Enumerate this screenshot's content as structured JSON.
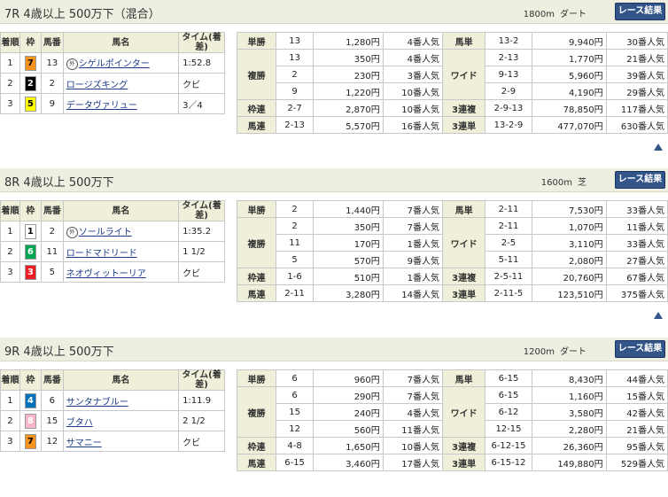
{
  "button_label": "レース結果",
  "res_headers": {
    "rank": "着順",
    "frame": "枠",
    "num": "馬番",
    "name": "馬名",
    "time": "タイム(着差)"
  },
  "pay_labels": {
    "tansho": "単勝",
    "fukusho": "複勝",
    "wakuren": "枠連",
    "umaren": "馬連",
    "umatan": "馬単",
    "wide": "ワイド",
    "sanrenpuku": "3連複",
    "sanrentan": "3連単"
  },
  "colors": {
    "header_bg": "#eeeee1",
    "th_bg": "#f0efd9",
    "button": "#335588",
    "link": "#1b3a8a"
  },
  "races": [
    {
      "title": "7R 4歳以上 500万下（混合）",
      "distance": "1800m",
      "surface": "ダート",
      "horses": [
        {
          "rank": "1",
          "frame": "7",
          "frame_bg": "#f7941d",
          "frame_fg": "#000000",
          "num": "13",
          "mark": "外",
          "name": "シゲルポインター",
          "time": "1:52.8"
        },
        {
          "rank": "2",
          "frame": "2",
          "frame_bg": "#000000",
          "frame_fg": "#ffffff",
          "num": "2",
          "mark": "",
          "name": "ロージズキング",
          "time": "クビ"
        },
        {
          "rank": "3",
          "frame": "5",
          "frame_bg": "#ffff00",
          "frame_fg": "#000000",
          "num": "9",
          "mark": "",
          "name": "データヴァリュー",
          "time": "3／4"
        }
      ],
      "payouts": {
        "tansho": {
          "combo": "13",
          "amount": "1,280円",
          "pop": "4番人気"
        },
        "fukusho": [
          {
            "combo": "13",
            "amount": "350円",
            "pop": "4番人気"
          },
          {
            "combo": "2",
            "amount": "230円",
            "pop": "3番人気"
          },
          {
            "combo": "9",
            "amount": "1,220円",
            "pop": "10番人気"
          }
        ],
        "wakuren": {
          "combo": "2-7",
          "amount": "2,870円",
          "pop": "10番人気"
        },
        "umaren": {
          "combo": "2-13",
          "amount": "5,570円",
          "pop": "16番人気"
        },
        "umatan": {
          "combo": "13-2",
          "amount": "9,940円",
          "pop": "30番人気"
        },
        "wide": [
          {
            "combo": "2-13",
            "amount": "1,770円",
            "pop": "21番人気"
          },
          {
            "combo": "9-13",
            "amount": "5,960円",
            "pop": "39番人気"
          },
          {
            "combo": "2-9",
            "amount": "4,190円",
            "pop": "29番人気"
          }
        ],
        "sanrenpuku": {
          "combo": "2-9-13",
          "amount": "78,850円",
          "pop": "117番人気"
        },
        "sanrentan": {
          "combo": "13-2-9",
          "amount": "477,070円",
          "pop": "630番人気"
        }
      }
    },
    {
      "title": "8R 4歳以上 500万下",
      "distance": "1600m",
      "surface": "芝",
      "horses": [
        {
          "rank": "1",
          "frame": "1",
          "frame_bg": "#ffffff",
          "frame_fg": "#000000",
          "num": "2",
          "mark": "外",
          "name": "ソールライト",
          "time": "1:35.2"
        },
        {
          "rank": "2",
          "frame": "6",
          "frame_bg": "#00a651",
          "frame_fg": "#ffffff",
          "num": "11",
          "mark": "",
          "name": "ロードマドリード",
          "time": "1 1/2"
        },
        {
          "rank": "3",
          "frame": "3",
          "frame_bg": "#ed1c24",
          "frame_fg": "#ffffff",
          "num": "5",
          "mark": "",
          "name": "ネオヴィットーリア",
          "time": "クビ"
        }
      ],
      "payouts": {
        "tansho": {
          "combo": "2",
          "amount": "1,440円",
          "pop": "7番人気"
        },
        "fukusho": [
          {
            "combo": "2",
            "amount": "350円",
            "pop": "7番人気"
          },
          {
            "combo": "11",
            "amount": "170円",
            "pop": "1番人気"
          },
          {
            "combo": "5",
            "amount": "570円",
            "pop": "9番人気"
          }
        ],
        "wakuren": {
          "combo": "1-6",
          "amount": "510円",
          "pop": "1番人気"
        },
        "umaren": {
          "combo": "2-11",
          "amount": "3,280円",
          "pop": "14番人気"
        },
        "umatan": {
          "combo": "2-11",
          "amount": "7,530円",
          "pop": "33番人気"
        },
        "wide": [
          {
            "combo": "2-11",
            "amount": "1,070円",
            "pop": "11番人気"
          },
          {
            "combo": "2-5",
            "amount": "3,110円",
            "pop": "33番人気"
          },
          {
            "combo": "5-11",
            "amount": "2,080円",
            "pop": "27番人気"
          }
        ],
        "sanrenpuku": {
          "combo": "2-5-11",
          "amount": "20,760円",
          "pop": "67番人気"
        },
        "sanrentan": {
          "combo": "2-11-5",
          "amount": "123,510円",
          "pop": "375番人気"
        }
      }
    },
    {
      "title": "9R 4歳以上 500万下",
      "distance": "1200m",
      "surface": "ダート",
      "horses": [
        {
          "rank": "1",
          "frame": "4",
          "frame_bg": "#0072bc",
          "frame_fg": "#ffffff",
          "num": "6",
          "mark": "",
          "name": "サンタナブルー",
          "time": "1:11.9"
        },
        {
          "rank": "2",
          "frame": "8",
          "frame_bg": "#f9b6c8",
          "frame_fg": "#ffffff",
          "num": "15",
          "mark": "",
          "name": "ブタハ",
          "time": "2 1/2"
        },
        {
          "rank": "3",
          "frame": "7",
          "frame_bg": "#f7941d",
          "frame_fg": "#000000",
          "num": "12",
          "mark": "",
          "name": "サマニー",
          "time": "クビ"
        }
      ],
      "payouts": {
        "tansho": {
          "combo": "6",
          "amount": "960円",
          "pop": "7番人気"
        },
        "fukusho": [
          {
            "combo": "6",
            "amount": "290円",
            "pop": "7番人気"
          },
          {
            "combo": "15",
            "amount": "240円",
            "pop": "4番人気"
          },
          {
            "combo": "12",
            "amount": "560円",
            "pop": "11番人気"
          }
        ],
        "wakuren": {
          "combo": "4-8",
          "amount": "1,650円",
          "pop": "10番人気"
        },
        "umaren": {
          "combo": "6-15",
          "amount": "3,460円",
          "pop": "17番人気"
        },
        "umatan": {
          "combo": "6-15",
          "amount": "8,430円",
          "pop": "44番人気"
        },
        "wide": [
          {
            "combo": "6-15",
            "amount": "1,160円",
            "pop": "15番人気"
          },
          {
            "combo": "6-12",
            "amount": "3,580円",
            "pop": "42番人気"
          },
          {
            "combo": "12-15",
            "amount": "2,280円",
            "pop": "21番人気"
          }
        ],
        "sanrenpuku": {
          "combo": "6-12-15",
          "amount": "26,360円",
          "pop": "95番人気"
        },
        "sanrentan": {
          "combo": "6-15-12",
          "amount": "149,880円",
          "pop": "529番人気"
        }
      }
    }
  ]
}
